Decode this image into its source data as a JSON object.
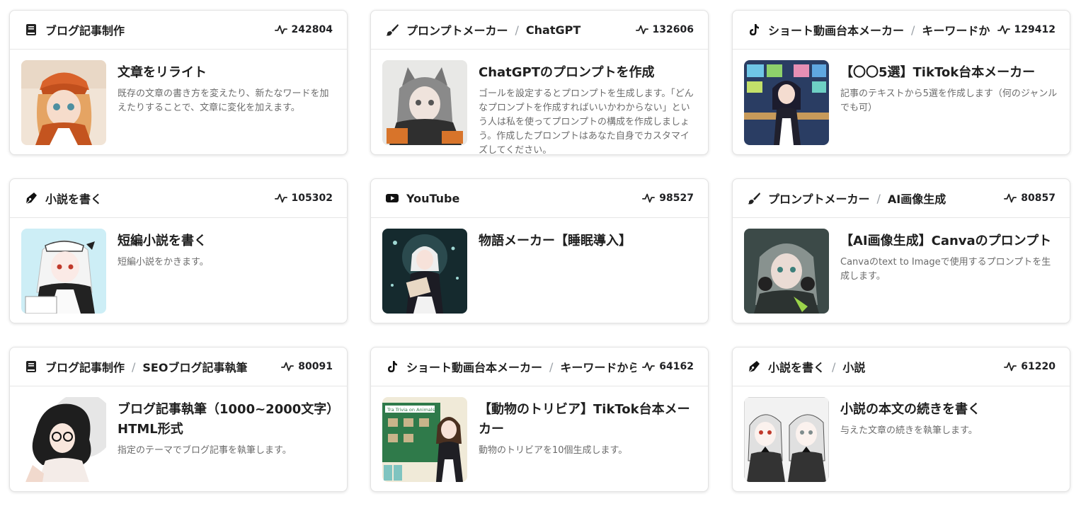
{
  "cards": [
    {
      "category": "ブログ記事制作",
      "subcategory": "",
      "icon": "book-icon",
      "views": "242804",
      "title": "文章をリライト",
      "description": "既存の文章の書き方を変えたり、新たなワードを加えたりすることで、文章に変化を加えます。",
      "thumb": "anime-girl-orange-cap"
    },
    {
      "category": "プロンプトメーカー",
      "subcategory": "ChatGPT",
      "icon": "brush-icon",
      "views": "132606",
      "title": "ChatGPTのプロンプトを作成",
      "description": "ゴールを設定するとプロンプトを生成します。「どんなプロンプトを作成すればいいかわからない」という人は私を使ってプロンプトの構成を作成しましょう。作成したプロンプトはあなた自身でカスタマイズしてください。",
      "thumb": "anime-girl-gray-hair"
    },
    {
      "category": "ショート動画台本メーカー",
      "subcategory": "キーワードから生成",
      "icon": "tiktok-icon",
      "views": "129412",
      "title": "【〇〇5選】TikTok台本メーカー",
      "description": "記事のテキストから5選を作成します（何のジャンルでも可）",
      "thumb": "anime-maid-at-desk"
    },
    {
      "category": "小説を書く",
      "subcategory": "",
      "icon": "pen-nib-icon",
      "views": "105302",
      "title": "短編小説を書く",
      "description": "短編小説をかきます。",
      "thumb": "anime-maid-writing"
    },
    {
      "category": "YouTube",
      "subcategory": "",
      "icon": "youtube-icon",
      "views": "98527",
      "title": "物語メーカー【睡眠導入】",
      "description": "",
      "thumb": "anime-maid-reading"
    },
    {
      "category": "プロンプトメーカー",
      "subcategory": "AI画像生成",
      "icon": "brush-icon",
      "views": "80857",
      "title": "【AI画像生成】Canvaのプロンプト",
      "description": "Canvaのtext to Imageで使用するプロンプトを生成します。",
      "thumb": "anime-girl-headphones"
    },
    {
      "category": "ブログ記事制作",
      "subcategory": "SEOブログ記事執筆",
      "icon": "book-icon",
      "views": "80091",
      "title": "ブログ記事執筆（1000~2000文字）HTML形式",
      "description": "指定のテーマでブログ記事を執筆します。",
      "thumb": "anime-girl-glasses"
    },
    {
      "category": "ショート動画台本メーカー",
      "subcategory": "キーワードから生成",
      "icon": "tiktok-icon",
      "views": "64162",
      "title": "【動物のトリビア】TikTok台本メーカー",
      "description": "動物のトリビアを10個生成します。",
      "thumb": "anime-maid-chalkboard",
      "thumb_text": "Tra Trivia on Animals"
    },
    {
      "category": "小説を書く",
      "subcategory": "小説",
      "icon": "pen-nib-icon",
      "views": "61220",
      "title": "小説の本文の続きを書く",
      "description": "与えた文章の続きを執筆します。",
      "thumb": "anime-twin-maids"
    }
  ],
  "colors": {
    "border": "#e3e3e3",
    "text": "#1f1f1f",
    "muted": "#6b6b6b",
    "separator": "#9aa0a6"
  }
}
